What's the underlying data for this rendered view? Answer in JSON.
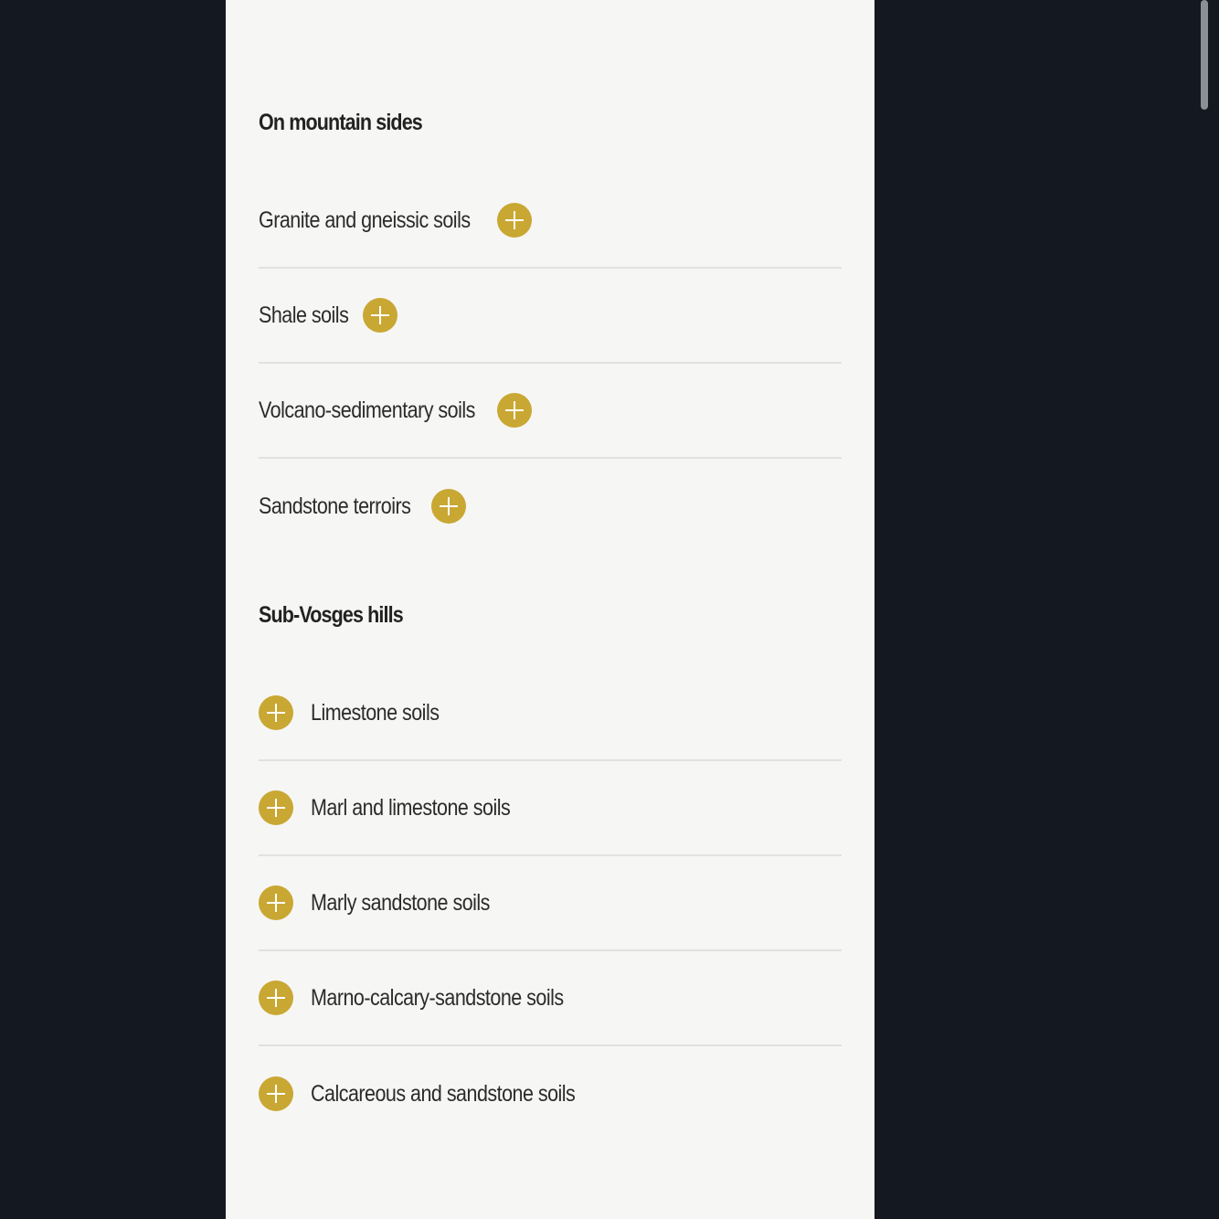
{
  "sections": [
    {
      "title": "On mountain sides",
      "items": [
        {
          "label": "Granite and gneissic soils"
        },
        {
          "label": "Shale soils"
        },
        {
          "label": "Volcano-sedimentary soils"
        },
        {
          "label": "Sandstone terroirs"
        }
      ]
    },
    {
      "title": "Sub-Vosges hills",
      "items": [
        {
          "label": "Limestone soils"
        },
        {
          "label": "Marl and limestone soils"
        },
        {
          "label": "Marly sandstone soils"
        },
        {
          "label": "Marno-calcary-sandstone soils"
        },
        {
          "label": "Calcareous and sandstone soils"
        }
      ]
    }
  ],
  "colors": {
    "accent": "#c9a733",
    "panel_bg": "#f6f6f4",
    "page_bg": "#141821",
    "divider": "#e1e1df"
  },
  "icons": {
    "expand": "plus-circle-icon"
  }
}
